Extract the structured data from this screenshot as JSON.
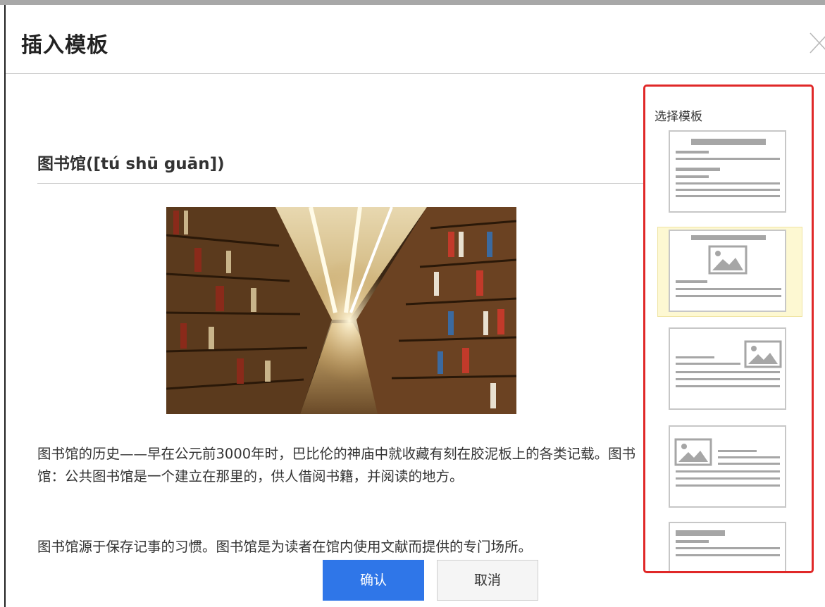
{
  "dialog": {
    "title": "插入模板",
    "close_glyph": "╳"
  },
  "preview": {
    "heading": "图书馆([tú shū guān])",
    "paragraph_1": "图书馆的历史——早在公元前3000年时，巴比伦的神庙中就收藏有刻在胶泥板上的各类记载。图书馆：公共图书馆是一个建立在那里的，供人借阅书籍，并阅读的地方。",
    "paragraph_2": "图书馆源于保存记事的习惯。图书馆是为读者在馆内使用文献而提供的专门场所。"
  },
  "buttons": {
    "confirm": "确认",
    "cancel": "取消"
  },
  "template_picker": {
    "label": "选择模板",
    "selected_index": 1,
    "templates": [
      {
        "layout": "text-only"
      },
      {
        "layout": "title-image-text"
      },
      {
        "layout": "text-image-right"
      },
      {
        "layout": "image-left-text"
      },
      {
        "layout": "text-only-alt"
      }
    ]
  },
  "colors": {
    "primary": "#2f76e8",
    "highlight_border": "#e02828",
    "selected_bg": "#fdf8d2",
    "thumb_line": "#a6a6a6"
  }
}
